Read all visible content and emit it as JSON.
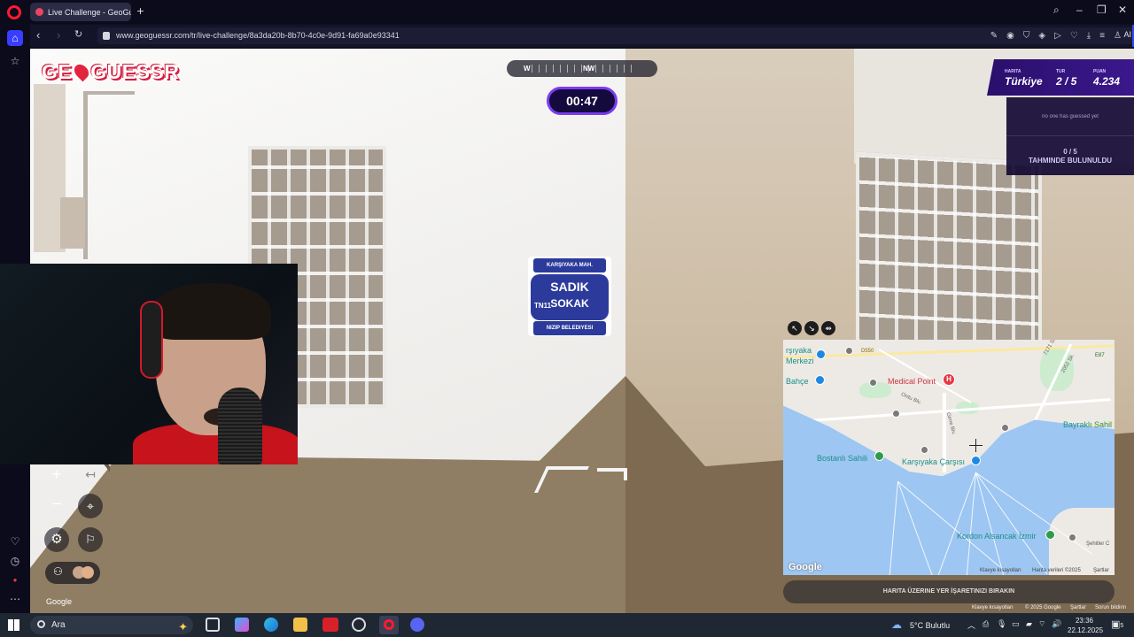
{
  "browser": {
    "tab_title": "Live Challenge - GeoGues",
    "url": "www.geoguessr.com/tr/live-challenge/8a3da20b-8b70-4c0e-9d91-fa69a0e93341",
    "ai_label": "AI"
  },
  "game": {
    "logo_text_left": "GE",
    "logo_text_right": "GUESSR",
    "timer": "00:47",
    "compass": {
      "left": "W",
      "center": "NW"
    },
    "score": {
      "map_label": "HARITA",
      "map_value": "Türkiye",
      "round_label": "TUR",
      "round_value": "2 / 5",
      "points_label": "PUAN",
      "points_value": "4.234"
    },
    "guess_panel": {
      "empty_text": "no one has guessed yet",
      "count": "0 / 5",
      "count_label": "TAHMINDE BULUNULDU"
    },
    "guess_button": "HARITA ÜZERINE YER İŞARETINIZI BIRAKIN",
    "google_text": "Google"
  },
  "sign": {
    "neighbourhood": "KARŞIYAKA MAH.",
    "street_name": "SADIK",
    "number": "TN11",
    "street_type": "SOKAK",
    "municipality": "NIZIP BELEDIYESI"
  },
  "map": {
    "labels": {
      "medical": "Medical Point",
      "medical_pin": "H",
      "karsiyaka": "Karşıyaka Çarşısı",
      "bostanli": "Bostanlı Sahili",
      "bayrakli": "Bayraklı Sahil",
      "kordon": "Kordon Alsancak İzmir",
      "sehitler": "Şehitler C",
      "bahce": "Bahçe",
      "rsiyaka": "rşıyaka",
      "merkezi": "Merkezi",
      "ordu": "Ordu Blv.",
      "girne": "Girne Blv.",
      "d550": "D550",
      "e87": "E87",
      "s7171": "7171 Sk.",
      "s2052": "2052 Sk."
    },
    "google": "Google",
    "footer": {
      "shortcuts": "Klavye kısayolları",
      "data": "Harita verileri ©2025",
      "terms": "Şartlar"
    }
  },
  "page_footer": {
    "shortcuts": "Klavye kısayolları",
    "copyright": "© 2025 Google",
    "terms": "Şartlar",
    "report": "Sorun bildirin"
  },
  "taskbar": {
    "search": "Ara",
    "weather": "5°C  Bulutlu",
    "time": "23:36",
    "date": "22.12.2025",
    "notif": "5"
  }
}
